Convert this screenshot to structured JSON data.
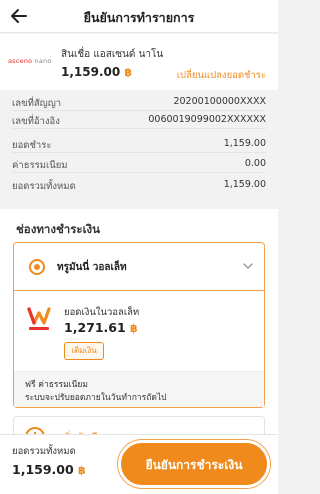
{
  "header": {
    "title": "ยืนยันการทำรายการ"
  },
  "product": {
    "logo_text_a": "asceno",
    "logo_text_b": " nano",
    "name": "สินเชื่อ แอสเซนด์ นาโน",
    "amount": "1,159.00",
    "currency_symbol": "฿",
    "change_link": "เปลี่ยนแปลงยอดชำระ"
  },
  "details": [
    {
      "label": "เลขที่สัญญา",
      "value": "20200100000XXXX"
    },
    {
      "label": "เลขที่อ้างอิง",
      "value": "0060019099002XXXXXX"
    },
    {
      "label": "ยอดชำระ",
      "value": "1,159.00"
    },
    {
      "label": "ค่าธรรมเนียม",
      "value": "0.00"
    },
    {
      "label": "ยอดรวมทั้งหมด",
      "value": "1,159.00"
    }
  ],
  "channel": {
    "title": "ช่องทางชำระเงิน",
    "wallet_name": "ทรูมันนี่ วอลเล็ท",
    "balance_label": "ยอดเงินในวอลเล็ท",
    "balance": "1,271.61",
    "topup_label": "เติมเงิน",
    "note_line1": "ฟรี ค่าธรรมเนียม",
    "note_line2": "ระบบจะปรับยอดภายในวันทำการถัดไป",
    "add_label": "เพิ่มบัญชีธนาคาร"
  },
  "footer": {
    "total_label": "ยอดรวมทั้งหมด",
    "total_amount": "1,159.00",
    "confirm_label": "ยืนยันการชำระเงิน"
  },
  "colors": {
    "accent": "#f08a1c",
    "brand_red": "#e8352c"
  },
  "icons": [
    "back-arrow-icon",
    "chevron-down-icon",
    "truemoney-logo-icon",
    "plus-circle-icon",
    "radio-selected-icon"
  ]
}
